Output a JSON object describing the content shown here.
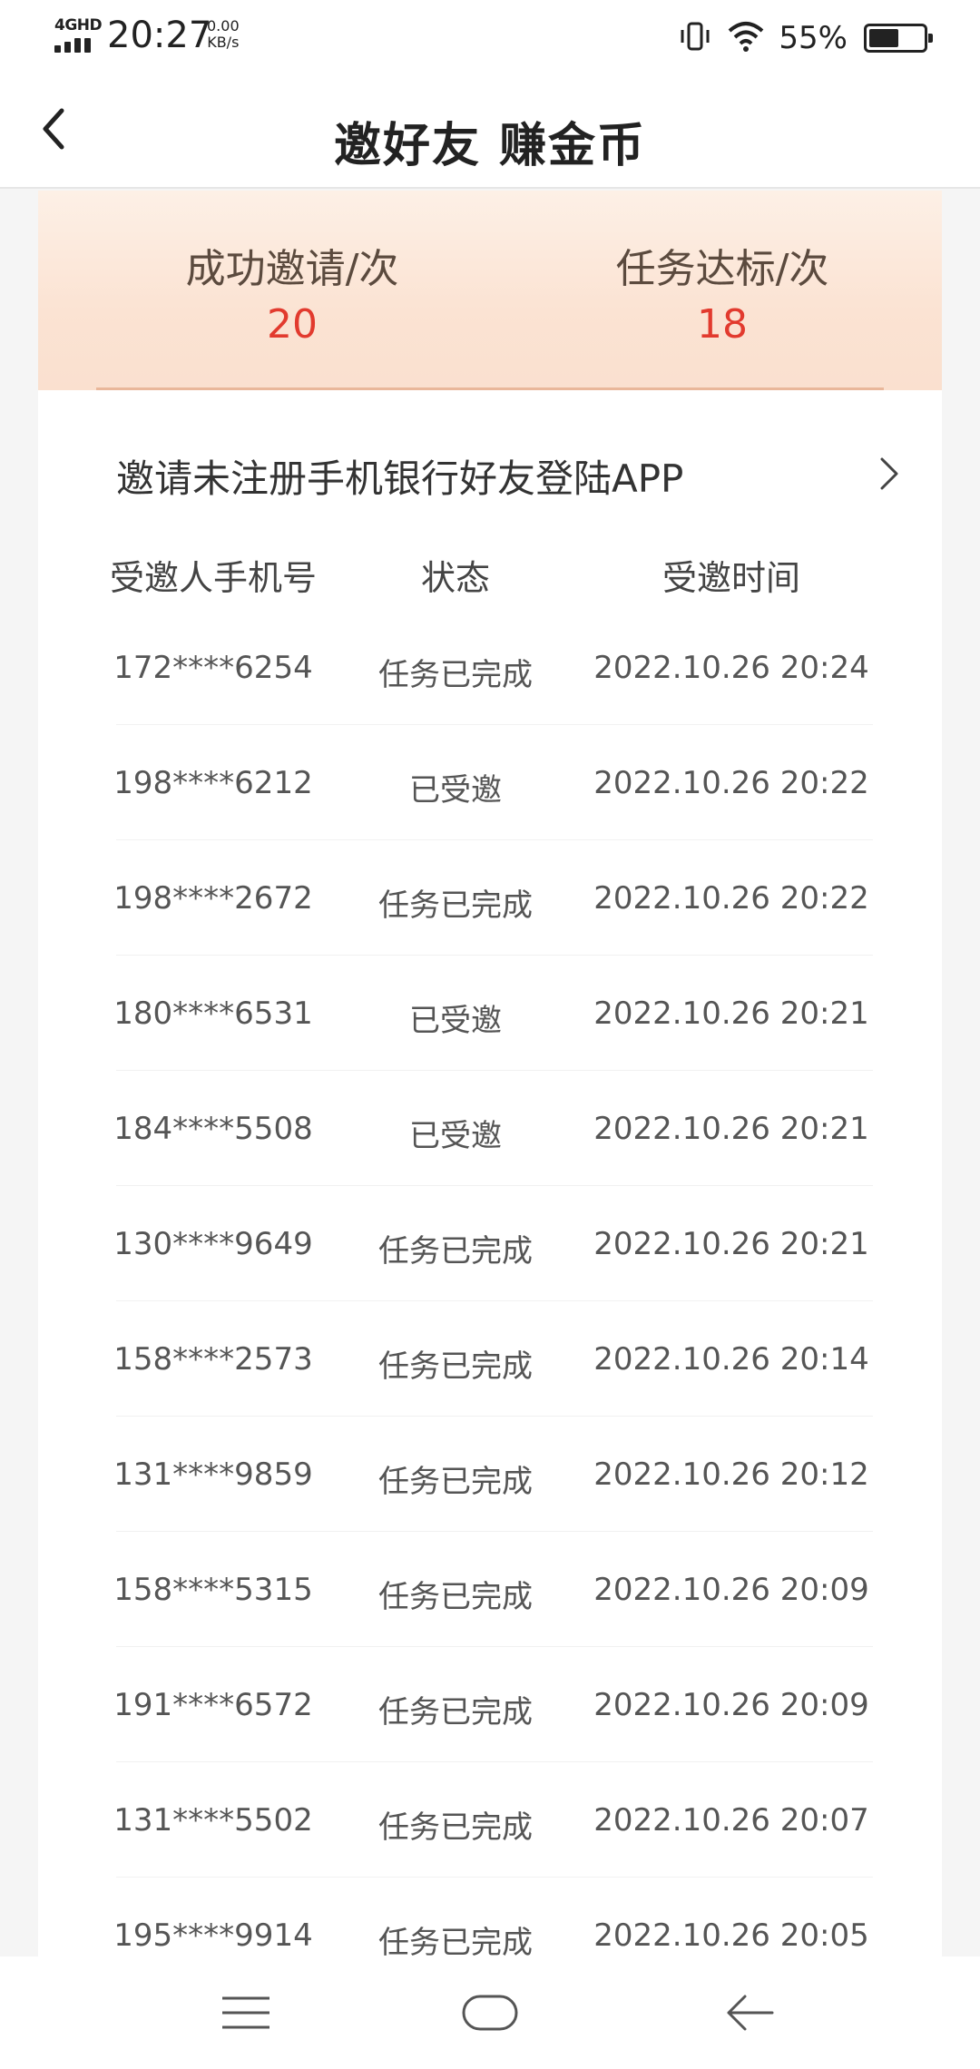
{
  "status_bar": {
    "network": "4GHD",
    "time": "20:27",
    "speed_value": "0.00",
    "speed_unit": "KB/s",
    "battery_percent": "55%",
    "battery_level": 0.55
  },
  "nav": {
    "title": "邀好友 赚金币",
    "back_icon": "chevron-left-icon"
  },
  "stats": {
    "invited_label": "成功邀请/次",
    "invited_value": "20",
    "completed_label": "任务达标/次",
    "completed_value": "18",
    "accent_color": "#e23a2e"
  },
  "invite_link": {
    "text": "邀请未注册手机银行好友登陆APP",
    "icon": "chevron-right-icon"
  },
  "table": {
    "headers": [
      "受邀人手机号",
      "状态",
      "受邀时间"
    ],
    "rows": [
      {
        "phone": "172****6254",
        "status": "任务已完成",
        "time": "2022.10.26 20:24"
      },
      {
        "phone": "198****6212",
        "status": "已受邀",
        "time": "2022.10.26 20:22"
      },
      {
        "phone": "198****2672",
        "status": "任务已完成",
        "time": "2022.10.26 20:22"
      },
      {
        "phone": "180****6531",
        "status": "已受邀",
        "time": "2022.10.26 20:21"
      },
      {
        "phone": "184****5508",
        "status": "已受邀",
        "time": "2022.10.26 20:21"
      },
      {
        "phone": "130****9649",
        "status": "任务已完成",
        "time": "2022.10.26 20:21"
      },
      {
        "phone": "158****2573",
        "status": "任务已完成",
        "time": "2022.10.26 20:14"
      },
      {
        "phone": "131****9859",
        "status": "任务已完成",
        "time": "2022.10.26 20:12"
      },
      {
        "phone": "158****5315",
        "status": "任务已完成",
        "time": "2022.10.26 20:09"
      },
      {
        "phone": "191****6572",
        "status": "任务已完成",
        "time": "2022.10.26 20:09"
      },
      {
        "phone": "131****5502",
        "status": "任务已完成",
        "time": "2022.10.26 20:07"
      },
      {
        "phone": "195****9914",
        "status": "任务已完成",
        "time": "2022.10.26 20:05"
      }
    ]
  },
  "system_nav": {
    "menu_icon": "menu-icon",
    "home_icon": "home-icon",
    "back_icon": "arrow-left-icon"
  }
}
